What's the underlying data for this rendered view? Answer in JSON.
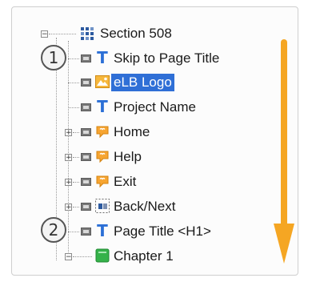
{
  "tree": {
    "root": {
      "label": "Section 508",
      "icon": "section-grid-icon"
    },
    "items": [
      {
        "label": "Skip to Page Title",
        "icon": "text-t-icon"
      },
      {
        "label": "eLB Logo",
        "icon": "image-icon",
        "selected": true
      },
      {
        "label": "Project Name",
        "icon": "text-t-icon"
      },
      {
        "label": "Home",
        "icon": "speech-bubble-icon"
      },
      {
        "label": "Help",
        "icon": "speech-bubble-icon"
      },
      {
        "label": "Exit",
        "icon": "speech-bubble-icon"
      },
      {
        "label": "Back/Next",
        "icon": "back-next-icon"
      },
      {
        "label": "Page Title <H1>",
        "icon": "text-t-icon"
      }
    ],
    "chapter": {
      "label": "Chapter 1",
      "icon": "chapter-icon"
    }
  },
  "annotations": {
    "badge1": "1",
    "badge2": "2"
  },
  "colors": {
    "selection": "#2f6fd6",
    "arrow": "#f5a623",
    "text_icon": "#2b6fd6"
  }
}
